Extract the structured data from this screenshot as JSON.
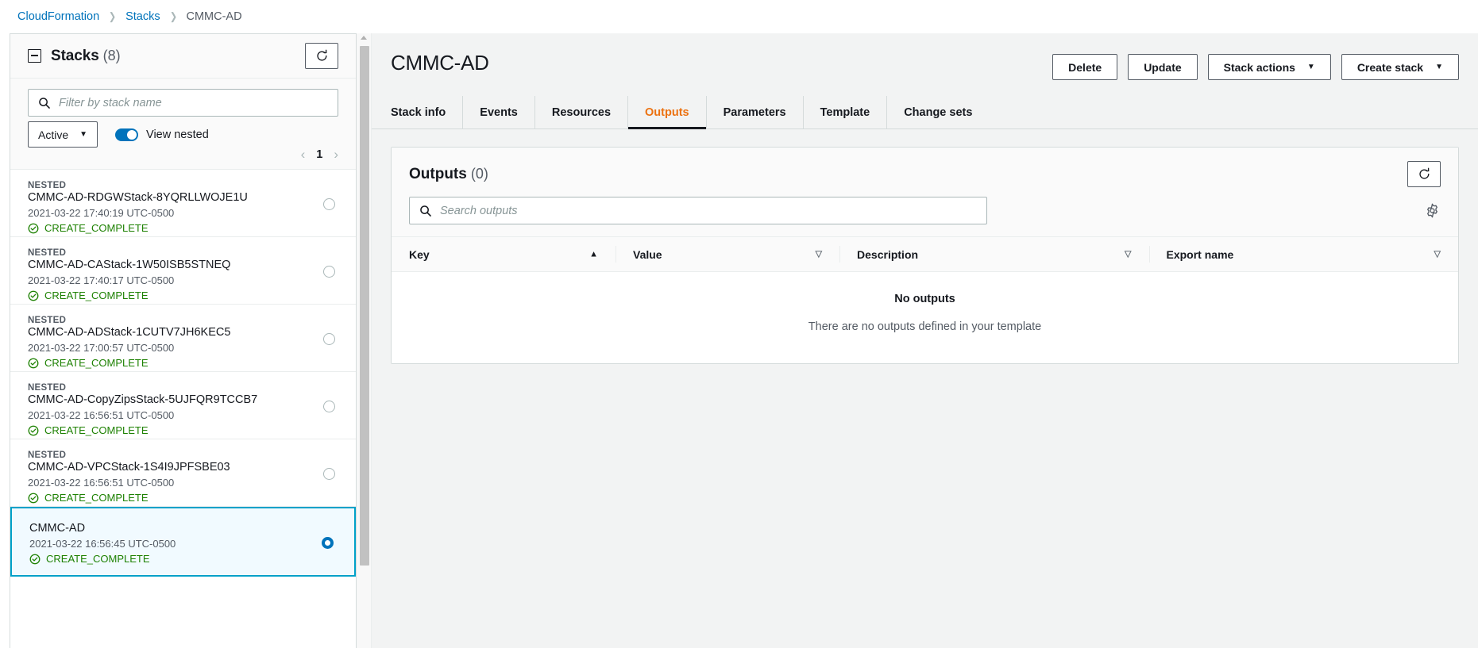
{
  "breadcrumb": {
    "items": [
      {
        "label": "CloudFormation",
        "type": "link"
      },
      {
        "label": "Stacks",
        "type": "link"
      },
      {
        "label": "CMMC-AD",
        "type": "current"
      }
    ],
    "separator": "❯"
  },
  "sidebar": {
    "title": "Stacks",
    "count": "(8)",
    "refresh_icon": "refresh-icon",
    "collapse_icon": "collapse-panel-icon",
    "filter": {
      "placeholder": "Filter by stack name",
      "value": "",
      "icon": "search-icon"
    },
    "status_select": {
      "value": "Active",
      "caret": "▼"
    },
    "view_nested": {
      "label": "View nested",
      "on": true
    },
    "pagination": {
      "prev": "‹",
      "page": "1",
      "next": "›"
    },
    "stacks": [
      {
        "badge": "NESTED",
        "name": "CMMC-AD-RDGWStack-8YQRLLWOJE1U",
        "date": "2021-03-22 17:40:19 UTC-0500",
        "status": "CREATE_COMPLETE",
        "selected": false
      },
      {
        "badge": "NESTED",
        "name": "CMMC-AD-CAStack-1W50ISB5STNEQ",
        "date": "2021-03-22 17:40:17 UTC-0500",
        "status": "CREATE_COMPLETE",
        "selected": false
      },
      {
        "badge": "NESTED",
        "name": "CMMC-AD-ADStack-1CUTV7JH6KEC5",
        "date": "2021-03-22 17:00:57 UTC-0500",
        "status": "CREATE_COMPLETE",
        "selected": false
      },
      {
        "badge": "NESTED",
        "name": "CMMC-AD-CopyZipsStack-5UJFQR9TCCB7",
        "date": "2021-03-22 16:56:51 UTC-0500",
        "status": "CREATE_COMPLETE",
        "selected": false
      },
      {
        "badge": "NESTED",
        "name": "CMMC-AD-VPCStack-1S4I9JPFSBE03",
        "date": "2021-03-22 16:56:51 UTC-0500",
        "status": "CREATE_COMPLETE",
        "selected": false
      },
      {
        "badge": "",
        "name": "CMMC-AD",
        "date": "2021-03-22 16:56:45 UTC-0500",
        "status": "CREATE_COMPLETE",
        "selected": true
      }
    ]
  },
  "main": {
    "title": "CMMC-AD",
    "actions": [
      {
        "label": "Delete",
        "caret": ""
      },
      {
        "label": "Update",
        "caret": ""
      },
      {
        "label": "Stack actions",
        "caret": "▼"
      },
      {
        "label": "Create stack",
        "caret": "▼"
      }
    ],
    "tabs": [
      {
        "label": "Stack info",
        "active": false
      },
      {
        "label": "Events",
        "active": false
      },
      {
        "label": "Resources",
        "active": false
      },
      {
        "label": "Outputs",
        "active": true
      },
      {
        "label": "Parameters",
        "active": false
      },
      {
        "label": "Template",
        "active": false
      },
      {
        "label": "Change sets",
        "active": false
      }
    ],
    "outputs_panel": {
      "title": "Outputs",
      "count": "(0)",
      "refresh_icon": "refresh-icon",
      "settings_icon": "gear-icon",
      "search": {
        "placeholder": "Search outputs",
        "value": "",
        "icon": "search-icon"
      },
      "columns": [
        {
          "label": "Key",
          "sort": "▲",
          "sorted": true
        },
        {
          "label": "Value",
          "sort": "▽",
          "sorted": false
        },
        {
          "label": "Description",
          "sort": "▽",
          "sorted": false
        },
        {
          "label": "Export name",
          "sort": "▽",
          "sorted": false
        }
      ],
      "empty": {
        "title": "No outputs",
        "subtitle": "There are no outputs defined in your template"
      }
    }
  },
  "colors": {
    "accent_orange": "#ec7211",
    "link_blue": "#0073bb",
    "success_green": "#1d8102",
    "selected_border": "#00a1c9",
    "selected_bg": "#f1faff"
  }
}
